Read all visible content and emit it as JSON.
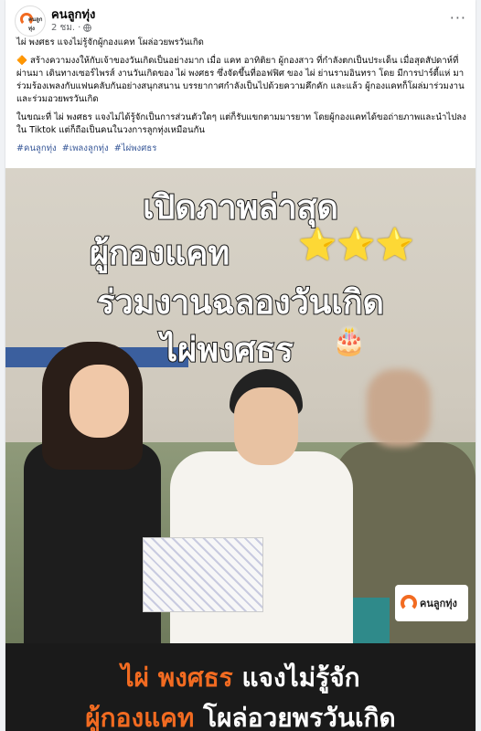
{
  "post": {
    "page_name": "คนลูกทุ่ง",
    "avatar_text": "คนลูกทุ่ง",
    "timestamp": "2 ชม.",
    "dot": "·",
    "more_label": "···",
    "text_para1": "ไผ่ พงศธร แจงไม่รู้จักผู้กองแคท โผล่อวยพรวันเกิด",
    "text_para2": "สร้างความงงให้กับเจ้าของวันเกิดเป็นอย่างมาก เมื่อ แคท อาทิติยา ผู้กองสาว ที่กำลังตกเป็นประเด็น เมื่อสุดสัปดาห์ที่ผ่านมา เดินทางเซอร์ไพรส์ งานวันเกิดของ ไผ่ พงศธร ซึ่งจัดขึ้นที่ออฟฟิศ ของ ไผ่ ย่านรามอินทรา โดย มีการปาร์ตี้แห่ มาร่วมร้องเพลงกับแฟนคลับกันอย่างสนุกสนาน บรรยากาศกำลังเป็นไปด้วยความคึกคัก และแล้ว ผู้กองแคทก็โผล่มาร่วมงาน และร่วมอวยพรวันเกิด",
    "diamond": "🔶",
    "text_para3": "ในขณะที่ ไผ่ พงศธร แจงไม่ได้รู้จักเป็นการส่วนตัวใดๆ แต่ก็รับแขกตามมารยาท โดยผู้กองแคทได้ขอถ่ายภาพและนำไปลงใน Tiktok แต่ก็ถือเป็นคนในวงการลูกทุ่งเหมือนกัน",
    "hashtags": [
      "#คนลูกทุ่ง",
      "#เพลงลูกทุ่ง",
      "#ไผ่พงศธร"
    ]
  },
  "image": {
    "title_line1": "เปิดภาพล่าสุด",
    "title_line2": "ผู้กองแคท",
    "stars": "⭐⭐⭐",
    "title_line3": "ร่วมงานฉลองวันเกิด",
    "title_line4": "ไผ่พงศธร",
    "cake": "🎂",
    "watermark_text": "คนลูกทุ่ง",
    "banner_line1_orange": "ไผ่ พงศธร",
    "banner_line1_white": "แจงไม่รู้จัก",
    "banner_line2_orange": "ผู้กองแคท",
    "banner_line2_white": "โผล่อวยพรวันเกิด"
  },
  "colors": {
    "brand_orange": "#f26b21",
    "link_blue": "#385898"
  }
}
